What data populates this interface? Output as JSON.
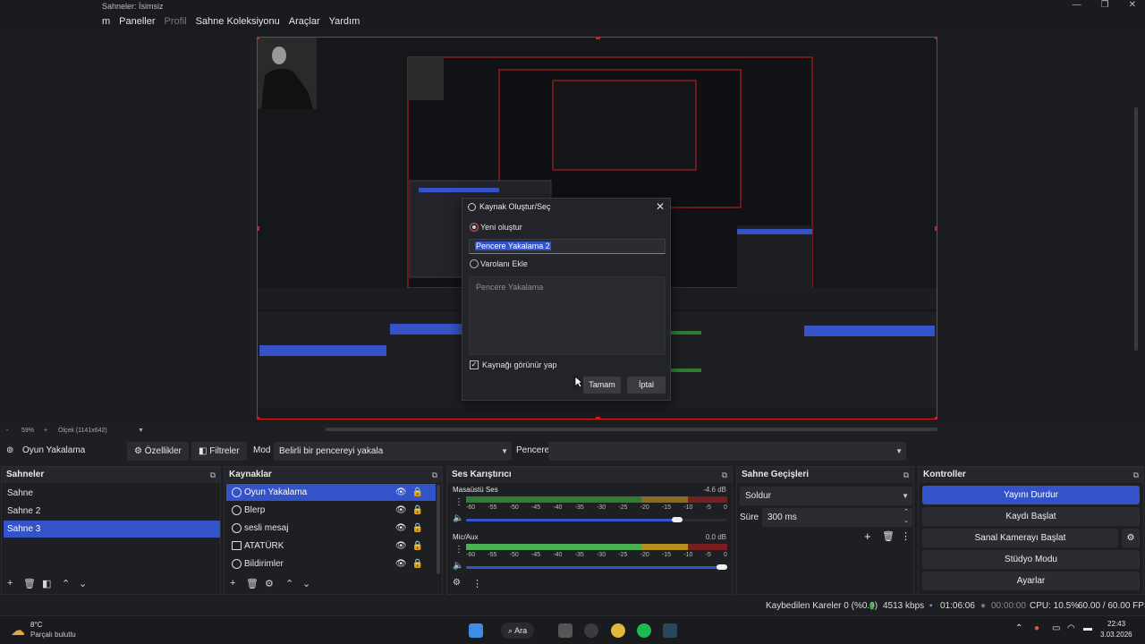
{
  "window": {
    "title": "Sahneler: İsimsiz",
    "min_icon": "—",
    "max_icon": "❐",
    "close_icon": "✕"
  },
  "menu": {
    "items": [
      "m",
      "Paneller",
      "Profil",
      "Sahne Koleksiyonu",
      "Araçlar",
      "Yardım"
    ]
  },
  "dialog": {
    "title": "Kaynak Oluştur/Seç",
    "create_new_label": "Yeni oluştur",
    "name_value": "Pencere Yakalama 2",
    "add_existing_label": "Varolanı Ekle",
    "existing_items": [
      "Pencere Yakalama"
    ],
    "visible_checkbox_label": "Kaynağı görünür yap",
    "ok_label": "Tamam",
    "cancel_label": "İptal"
  },
  "zoom": {
    "minus": "-",
    "level": "59%",
    "plus": "+",
    "scale_label": "Ölçek (1141x642)"
  },
  "source_toolbar": {
    "source_name": "Oyun Yakalama",
    "properties_label": "Özellikler",
    "filters_label": "Filtreler",
    "mode_label": "Mod",
    "mode_value": "Belirli bir pencereyi yakala",
    "window_label": "Pencere",
    "window_value": ""
  },
  "scenes": {
    "title": "Sahneler",
    "items": [
      "Sahne",
      "Sahne 2",
      "Sahne 3"
    ],
    "selected_index": 2
  },
  "sources": {
    "title": "Kaynaklar",
    "items": [
      "Oyun Yakalama",
      "Blerp",
      "sesli mesaj",
      "ATATÜRK",
      "Bildirimler"
    ]
  },
  "mixer": {
    "title": "Ses Karıştırıcı",
    "channels": [
      {
        "name": "Masaüstü Ses",
        "db": "-4.6 dB",
        "volume": 0.83
      },
      {
        "name": "Mic/Aux",
        "db": "0.0 dB",
        "volume": 1.0
      }
    ],
    "scale": [
      "-60",
      "-55",
      "-50",
      "-45",
      "-40",
      "-35",
      "-30",
      "-25",
      "-20",
      "-15",
      "-10",
      "-5",
      "0"
    ]
  },
  "transitions": {
    "title": "Sahne Geçişleri",
    "type": "Soldur",
    "duration_label": "Süre",
    "duration_value": "300 ms"
  },
  "controls": {
    "title": "Kontroller",
    "buttons": [
      "Yayını Durdur",
      "Kaydı Başlat",
      "Sanal Kamerayı Başlat",
      "Stüdyo Modu",
      "Ayarlar"
    ]
  },
  "status": {
    "dropped_frames": "Kaybedilen Kareler 0 (%0.0)",
    "bitrate": "4513 kbps",
    "stream_time": "01:06:06",
    "record_time": "00:00:00",
    "cpu": "CPU: 10.5%",
    "fps": "60.00 / 60.00 FPS"
  },
  "taskbar": {
    "weather_temp": "8°C",
    "weather_desc": "Parçalı bulutlu",
    "search_label": "Ara",
    "time": "22:43",
    "date": "3.03.2026"
  },
  "colors": {
    "accent": "#3553c9",
    "selection_red": "#d91c1c",
    "meter_green": "#2e7d32"
  }
}
